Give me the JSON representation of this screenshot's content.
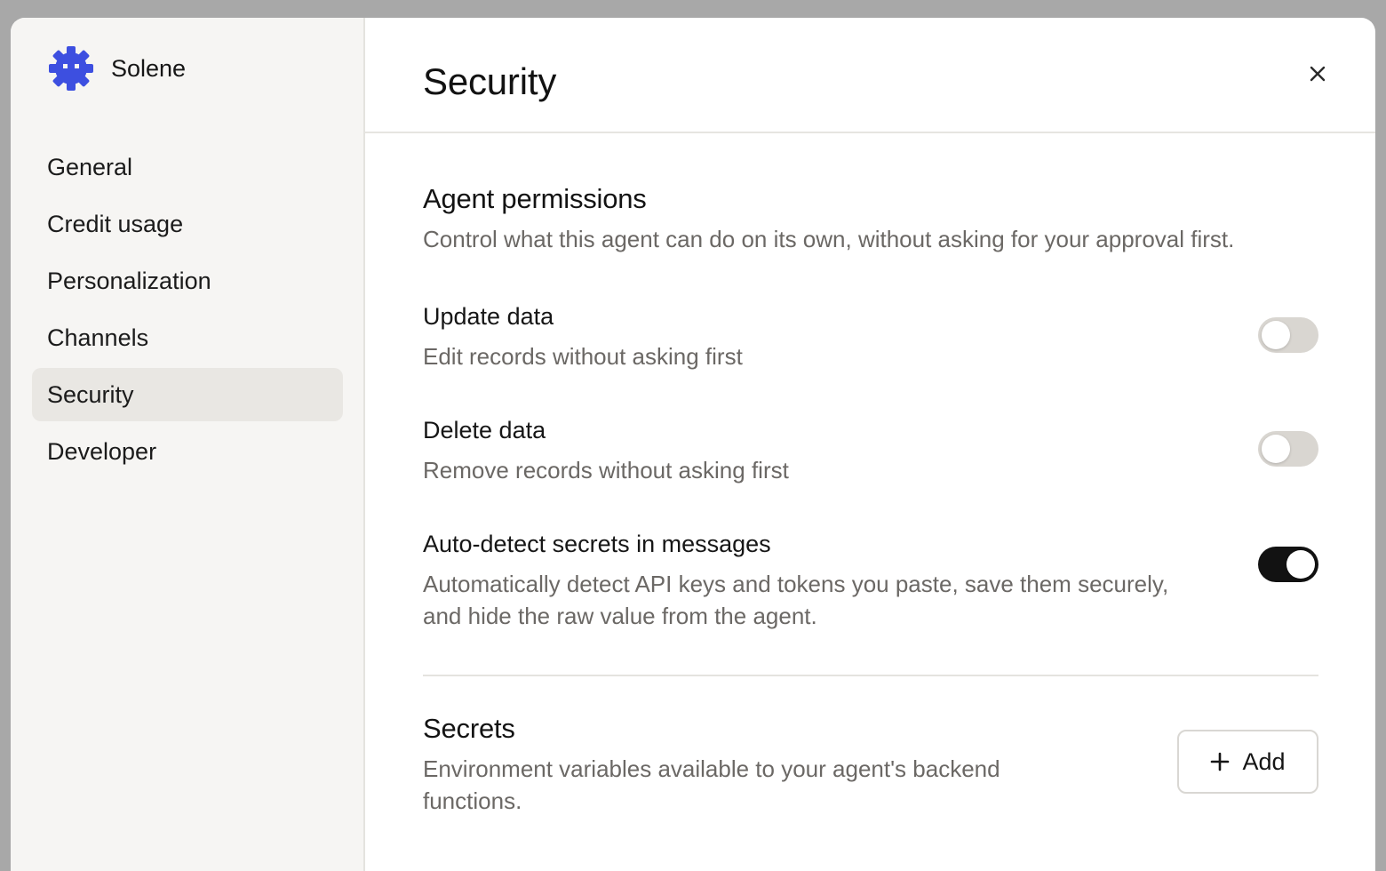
{
  "app": {
    "name": "Solene",
    "logo_icon": "gear-bot-icon",
    "accent": "#3d4fe0"
  },
  "sidebar": {
    "items": [
      {
        "label": "General"
      },
      {
        "label": "Credit usage"
      },
      {
        "label": "Personalization"
      },
      {
        "label": "Channels"
      },
      {
        "label": "Security",
        "active": true
      },
      {
        "label": "Developer"
      }
    ]
  },
  "header": {
    "title": "Security",
    "close_icon": "close-icon"
  },
  "permissions": {
    "title": "Agent permissions",
    "description": "Control what this agent can do on its own, without asking for your approval first.",
    "settings": [
      {
        "title": "Update data",
        "description": "Edit records without asking first",
        "enabled": false
      },
      {
        "title": "Delete data",
        "description": "Remove records without asking first",
        "enabled": false
      },
      {
        "title": "Auto-detect secrets in messages",
        "description": "Automatically detect API keys and tokens you paste, save them securely, and hide the raw value from the agent.",
        "enabled": true
      }
    ]
  },
  "secrets": {
    "title": "Secrets",
    "description": "Environment variables available to your agent's backend functions.",
    "add_label": "Add",
    "add_icon": "plus-icon"
  },
  "colors": {
    "toggle_on": "#121212",
    "toggle_off": "#d9d6d1",
    "sidebar_bg": "#f6f5f3",
    "active_item_bg": "#e9e7e3"
  }
}
